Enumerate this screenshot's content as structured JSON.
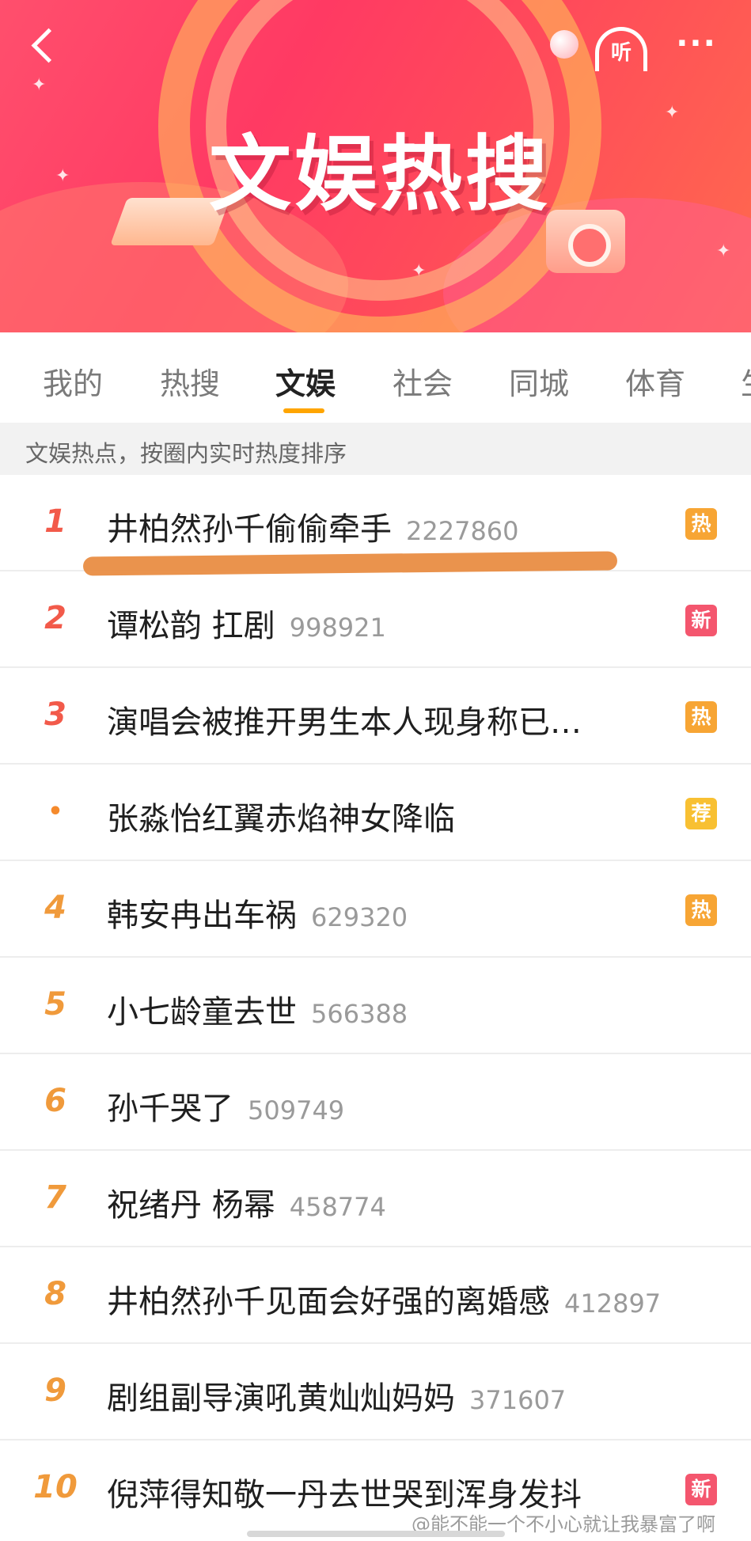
{
  "banner": {
    "title": "文娱热搜",
    "listen_label": "听",
    "more_label": "···"
  },
  "tabs": [
    {
      "label": "我的",
      "active": false
    },
    {
      "label": "热搜",
      "active": false
    },
    {
      "label": "文娱",
      "active": true
    },
    {
      "label": "社会",
      "active": false
    },
    {
      "label": "同城",
      "active": false
    },
    {
      "label": "体育",
      "active": false
    },
    {
      "label": "生",
      "active": false
    }
  ],
  "subheader": "文娱热点，按圈内实时热度排序",
  "list": [
    {
      "rank": "1",
      "title": "井柏然孙千偷偷牵手",
      "count": "2227860",
      "badge": "热",
      "badge_type": "hot",
      "highlighted": true
    },
    {
      "rank": "2",
      "title": "谭松韵 扛剧",
      "count": "998921",
      "badge": "新",
      "badge_type": "new"
    },
    {
      "rank": "3",
      "title": "演唱会被推开男生本人现身称已…",
      "count": "",
      "badge": "热",
      "badge_type": "hot"
    },
    {
      "rank": "•",
      "title": "张淼怡红翼赤焰神女降临",
      "count": "",
      "badge": "荐",
      "badge_type": "rec"
    },
    {
      "rank": "4",
      "title": "韩安冉出车祸",
      "count": "629320",
      "badge": "热",
      "badge_type": "hot"
    },
    {
      "rank": "5",
      "title": "小七龄童去世",
      "count": "566388",
      "badge": "",
      "badge_type": ""
    },
    {
      "rank": "6",
      "title": "孙千哭了",
      "count": "509749",
      "badge": "",
      "badge_type": ""
    },
    {
      "rank": "7",
      "title": "祝绪丹 杨幂",
      "count": "458774",
      "badge": "",
      "badge_type": ""
    },
    {
      "rank": "8",
      "title": "井柏然孙千见面会好强的离婚感",
      "count": "412897",
      "badge": "",
      "badge_type": ""
    },
    {
      "rank": "9",
      "title": "剧组副导演吼黄灿灿妈妈",
      "count": "371607",
      "badge": "",
      "badge_type": ""
    },
    {
      "rank": "10",
      "title": "倪萍得知敬一丹去世哭到浑身发抖",
      "count": "",
      "badge": "新",
      "badge_type": "new"
    }
  ],
  "watermark": "@能不能一个不小心就让我暴富了啊",
  "colors": {
    "accent": "#ffa500",
    "rank_top": "#f25a4a",
    "rank_other": "#f09a3b",
    "badge_hot": "#f7a534",
    "badge_new": "#f4566e",
    "badge_rec": "#f8c032",
    "highlight_mark": "#e88a3e"
  }
}
